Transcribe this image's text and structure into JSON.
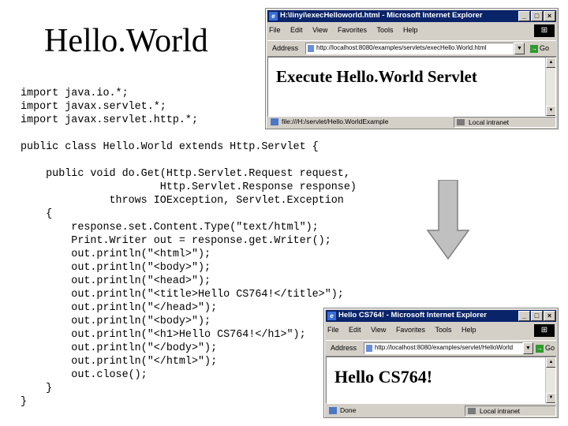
{
  "slide": {
    "title": "Hello.World"
  },
  "code_lines": [
    "import java.io.*;",
    "import javax.servlet.*;",
    "import javax.servlet.http.*;",
    "",
    "public class Hello.World extends Http.Servlet {",
    "",
    "    public void do.Get(Http.Servlet.Request request,",
    "                      Http.Servlet.Response response)",
    "              throws IOException, Servlet.Exception",
    "    {",
    "        response.set.Content.Type(\"text/html\");",
    "        Print.Writer out = response.get.Writer();",
    "        out.println(\"<html>\");",
    "        out.println(\"<body>\");",
    "        out.println(\"<head>\");",
    "        out.println(\"<title>Hello CS764!</title>\");",
    "        out.println(\"</head>\");",
    "        out.println(\"<body>\");",
    "        out.println(\"<h1>Hello CS764!</h1>\");",
    "        out.println(\"</body>\");",
    "        out.println(\"</html>\");",
    "        out.close();",
    "    }",
    "}"
  ],
  "browser_top": {
    "window_title": "H:\\linyi\\execHelloworld.html - Microsoft Internet Explorer",
    "menu": [
      "File",
      "Edit",
      "View",
      "Favorites",
      "Tools",
      "Help"
    ],
    "address_label": "Address",
    "address_url": "http://localhost:8080/examples/servlets/execHello.World.html",
    "go_label": "Go",
    "page_heading": "Execute Hello.World Servlet",
    "status_text": "file:///H:/servlet/Hello.WorldExample",
    "status_zone": "Local intranet"
  },
  "browser_bottom": {
    "window_title": "Hello CS764! - Microsoft Internet Explorer",
    "menu": [
      "File",
      "Edit",
      "View",
      "Favorites",
      "Tools",
      "Help"
    ],
    "address_label": "Address",
    "address_url": "http://localhost:8080/examples/servlet/HelloWorld",
    "go_label": "Go",
    "page_heading": "Hello CS764!",
    "status_text": "Done",
    "status_zone": "Local intranet"
  },
  "colors": {
    "titlebar": "#0a246a",
    "window_chrome": "#d4d0c8",
    "keyword": "#0000cc",
    "arrow_fill": "#c0c0c0"
  },
  "icons": [
    "ie-logo-icon",
    "minimize-icon",
    "maximize-icon",
    "close-icon",
    "page-icon",
    "go-arrow-icon",
    "scroll-up-icon",
    "scroll-down-icon",
    "status-page-icon",
    "intranet-icon",
    "down-arrow-icon"
  ]
}
